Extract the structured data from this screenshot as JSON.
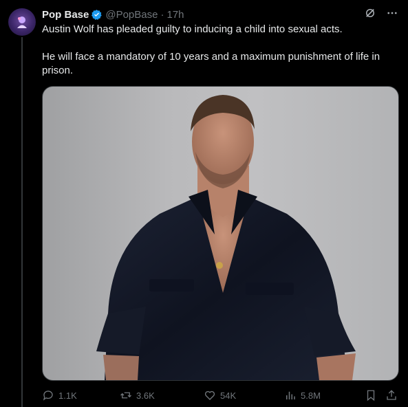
{
  "tweet": {
    "author_name": "Pop Base",
    "author_handle": "@PopBase",
    "separator": "·",
    "time": "17h",
    "paragraphs": [
      "Austin Wolf has pleaded guilty to inducing a child into sexual acts.",
      "He will face a mandatory of 10 years and a maximum punishment of life in prison."
    ]
  },
  "header_icons": [
    "grok-icon",
    "more-icon"
  ],
  "actions": {
    "replies": "1.1K",
    "retweets": "3.6K",
    "likes": "54K",
    "views": "5.8M"
  },
  "colors": {
    "background": "#000000",
    "text": "#e7e9ea",
    "muted": "#71767b",
    "verified": "#1d9bf0",
    "divider": "#333639"
  }
}
